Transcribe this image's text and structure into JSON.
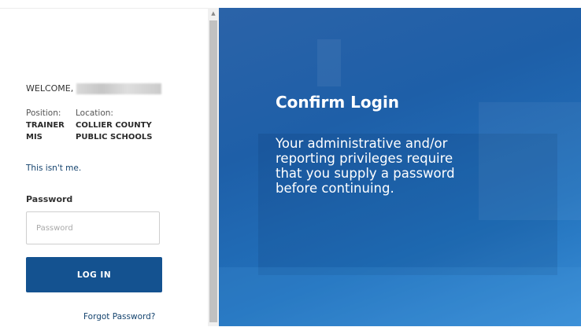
{
  "welcome": {
    "label": "WELCOME,"
  },
  "profile": {
    "position_label": "Position:",
    "position_value": "TRAINER MIS",
    "location_label": "Location:",
    "location_value": "COLLIER COUNTY PUBLIC SCHOOLS"
  },
  "not_me_link": "This isn't me.",
  "password": {
    "label": "Password",
    "placeholder": "Password",
    "value": ""
  },
  "login_button": "LOG IN",
  "forgot_link": "Forgot Password?",
  "confirm": {
    "title": "Confirm Login",
    "message": "Your administrative and/or reporting privileges require that you supply a password before continuing."
  },
  "colors": {
    "primary_button": "#145290",
    "link": "#14436e",
    "panel_blue": "#1e5fa8"
  },
  "icons": {
    "scroll_up": "triangle-up-icon"
  }
}
